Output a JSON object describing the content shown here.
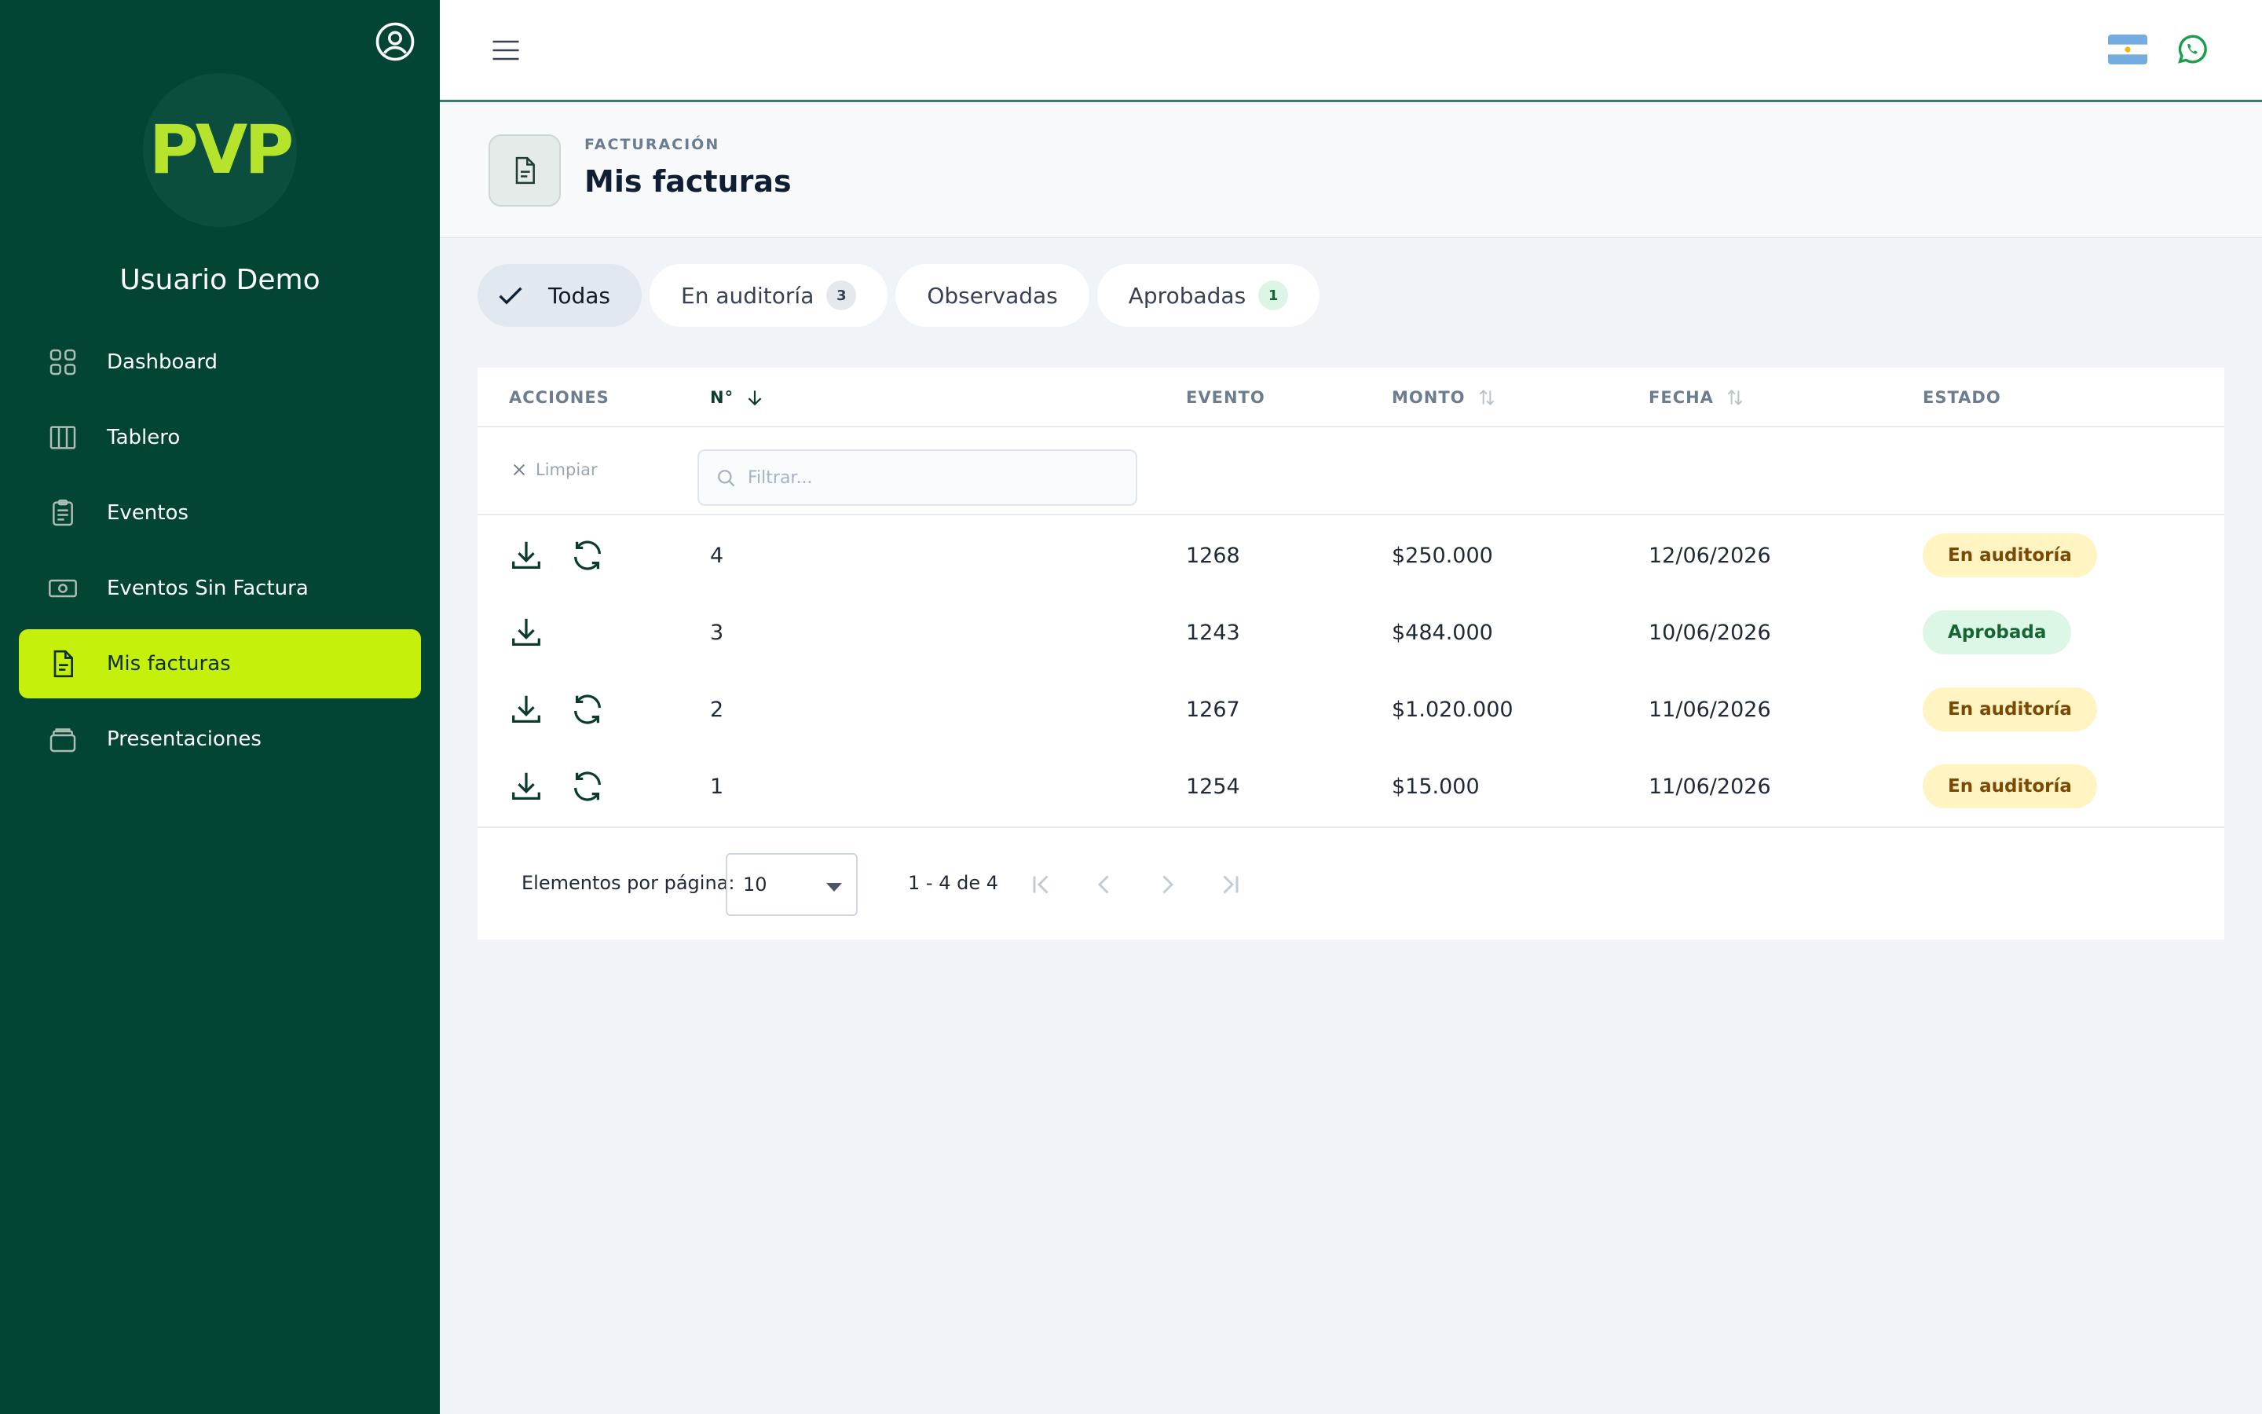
{
  "sidebar": {
    "logo_text": "PVP",
    "user_name": "Usuario Demo",
    "items": [
      {
        "label": "Dashboard",
        "icon": "grid-icon"
      },
      {
        "label": "Tablero",
        "icon": "columns-icon"
      },
      {
        "label": "Eventos",
        "icon": "clipboard-icon"
      },
      {
        "label": "Eventos Sin Factura",
        "icon": "banknote-icon"
      },
      {
        "label": "Mis facturas",
        "icon": "document-icon",
        "active": true
      },
      {
        "label": "Presentaciones",
        "icon": "stack-icon"
      }
    ]
  },
  "header": {
    "kicker": "FACTURACIÓN",
    "title": "Mis facturas"
  },
  "tabs": [
    {
      "label": "Todas",
      "active": true
    },
    {
      "label": "En auditoría",
      "count": "3"
    },
    {
      "label": "Observadas"
    },
    {
      "label": "Aprobadas",
      "count": "1"
    }
  ],
  "table": {
    "columns": {
      "actions": "ACCIONES",
      "number": "N°",
      "event": "EVENTO",
      "amount": "MONTO",
      "date": "FECHA",
      "status": "ESTADO"
    },
    "clear_label": "Limpiar",
    "filter_placeholder": "Filtrar...",
    "rows": [
      {
        "number": "4",
        "event": "1268",
        "amount": "$250.000",
        "date": "12/06/2026",
        "status": "En auditoría",
        "refresh": true
      },
      {
        "number": "3",
        "event": "1243",
        "amount": "$484.000",
        "date": "10/06/2026",
        "status": "Aprobada",
        "refresh": false
      },
      {
        "number": "2",
        "event": "1267",
        "amount": "$1.020.000",
        "date": "11/06/2026",
        "status": "En auditoría",
        "refresh": true
      },
      {
        "number": "1",
        "event": "1254",
        "amount": "$15.000",
        "date": "11/06/2026",
        "status": "En auditoría",
        "refresh": true
      }
    ]
  },
  "paginator": {
    "label": "Elementos por página:",
    "page_size": "10",
    "range": "1 - 4 de 4"
  },
  "colors": {
    "sidebar_bg": "#024535",
    "accent": "#c5f00b",
    "logo": "#b6e32b",
    "audit_bg": "#fff4c2",
    "approved_bg": "#dcf7e6"
  }
}
